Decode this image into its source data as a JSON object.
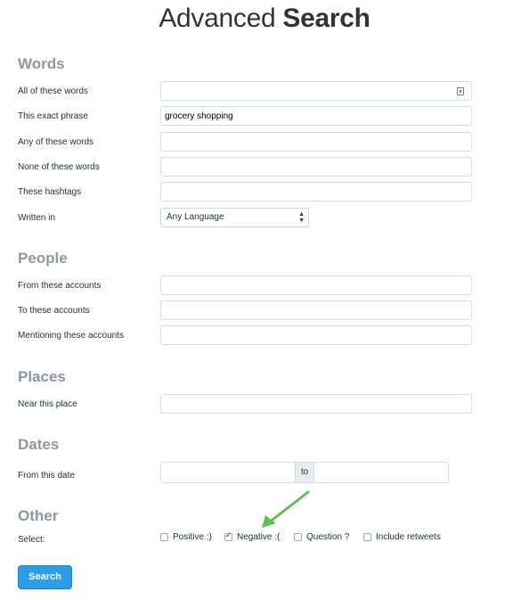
{
  "title": {
    "light": "Advanced",
    "bold": "Search"
  },
  "words": {
    "heading": "Words",
    "all_label": "All of these words",
    "all_value": "",
    "exact_label": "This exact phrase",
    "exact_value": "grocery shopping",
    "any_label": "Any of these words",
    "any_value": "",
    "none_label": "None of these words",
    "none_value": "",
    "hashtags_label": "These hashtags",
    "hashtags_value": "",
    "written_label": "Written in",
    "language_selected": "Any Language"
  },
  "people": {
    "heading": "People",
    "from_label": "From these accounts",
    "to_label": "To these accounts",
    "mentioning_label": "Mentioning these accounts"
  },
  "places": {
    "heading": "Places",
    "near_label": "Near this place"
  },
  "dates": {
    "heading": "Dates",
    "from_label": "From this date",
    "to_label": "to"
  },
  "other": {
    "heading": "Other",
    "select_label": "Select:",
    "options": [
      {
        "label": "Positive :)",
        "checked": false
      },
      {
        "label": "Negative :(",
        "checked": true
      },
      {
        "label": "Question ?",
        "checked": false
      },
      {
        "label": "Include retweets",
        "checked": false
      }
    ]
  },
  "search_button": "Search",
  "colors": {
    "accent": "#2b9de9",
    "section": "#8899a6",
    "annotation_arrow": "#5cc24f"
  }
}
